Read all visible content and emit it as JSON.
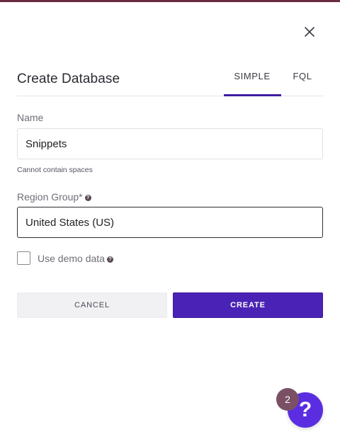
{
  "dialog": {
    "title": "Create Database",
    "close_icon": "close-icon",
    "tabs": [
      {
        "label": "SIMPLE",
        "active": true
      },
      {
        "label": "FQL",
        "active": false
      }
    ]
  },
  "form": {
    "name": {
      "label": "Name",
      "value": "Snippets",
      "hint": "Cannot contain spaces"
    },
    "region": {
      "label": "Region Group*",
      "value": "United States (US)",
      "help_icon": "help-icon"
    },
    "demo": {
      "label": "Use demo data",
      "checked": false,
      "help_icon": "help-icon"
    }
  },
  "actions": {
    "cancel_label": "CANCEL",
    "create_label": "CREATE"
  },
  "help_widget": {
    "badge_count": "2",
    "icon": "?"
  },
  "colors": {
    "accent": "#4a22b5",
    "tab_indicator": "#3f1da3",
    "fab": "#5b2de0",
    "badge": "#7a5064"
  }
}
